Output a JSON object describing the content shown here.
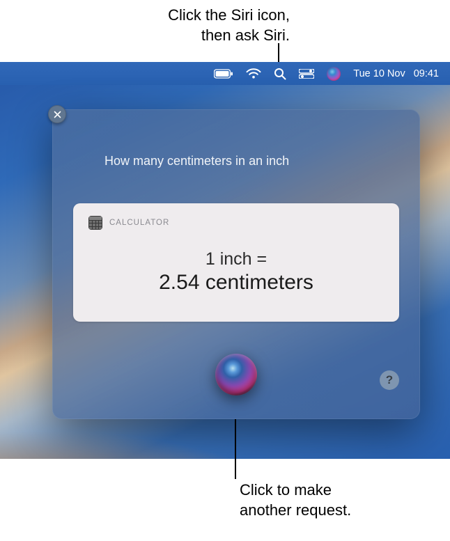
{
  "annotations": {
    "top_line1": "Click the Siri icon,",
    "top_line2": "then ask Siri.",
    "bottom_line1": "Click to make",
    "bottom_line2": "another request."
  },
  "menubar": {
    "date": "Tue 10 Nov",
    "time": "09:41"
  },
  "siri": {
    "query": "How many centimeters in an inch",
    "card": {
      "source": "CALCULATOR",
      "result_line1": "1 inch =",
      "result_line2": "2.54 centimeters"
    },
    "help_label": "?"
  }
}
